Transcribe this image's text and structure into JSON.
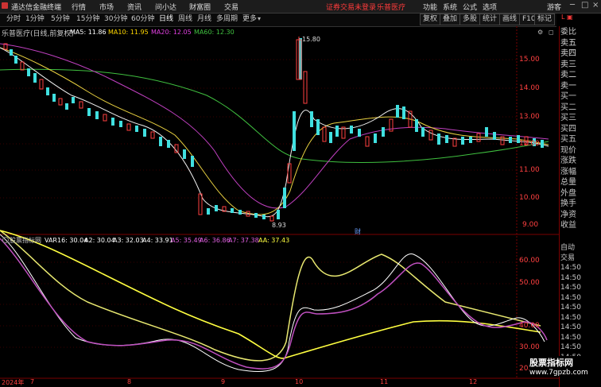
{
  "menubar": {
    "brand": "通达信金融终端",
    "items": [
      "行情",
      "市场",
      "资讯",
      "问小达",
      "财富圈",
      "交易"
    ],
    "alert": "证券交易未登录",
    "stock_name": "乐普医疗",
    "right_items": [
      "功能",
      "系统",
      "公式",
      "选项"
    ],
    "user": "游客"
  },
  "toolbar": {
    "periods": [
      "分时",
      "1分钟",
      "5分钟",
      "15分钟",
      "30分钟",
      "60分钟",
      "日线",
      "周线",
      "月线",
      "多周期",
      "更多"
    ],
    "active": "日线",
    "right_buttons": [
      "复权",
      "叠加",
      "多股",
      "统计",
      "画线",
      "F10",
      "标记"
    ]
  },
  "main_chart": {
    "title": "乐普医疗(日线,前复权)",
    "ma_labels": [
      {
        "text": "MA5: 11.86",
        "color": "#ffffff"
      },
      {
        "text": "MA10: 11.95",
        "color": "#ffd700"
      },
      {
        "text": "MA20: 12.05",
        "color": "#e040e0"
      },
      {
        "text": "MA60: 12.30",
        "color": "#40c040"
      }
    ],
    "high_label": "15.80",
    "low_label": "8.93",
    "event_label": "财",
    "marker_left": "s",
    "marker_mid": "s",
    "y_ticks": [
      "15.00",
      "14.00",
      "13.00",
      "12.00",
      "11.00",
      "10.00",
      "9.00"
    ]
  },
  "indicator": {
    "title": "股票指标网",
    "values": [
      {
        "text": "VAR16: 30.04",
        "color": "#ffffff"
      },
      {
        "text": "A2: 30.04",
        "color": "#ffffff"
      },
      {
        "text": "A3: 32.03",
        "color": "#ffffff"
      },
      {
        "text": "A4: 33.91",
        "color": "#ffffff"
      },
      {
        "text": "A5: 35.49",
        "color": "#e060e0"
      },
      {
        "text": "A6: 36.86",
        "color": "#e060e0"
      },
      {
        "text": "A7: 37.38",
        "color": "#e060e0"
      },
      {
        "text": "AA: 37.43",
        "color": "#ffff40"
      }
    ],
    "y_ticks": [
      "60.00",
      "50.00",
      "40.00",
      "30.00",
      "20.00"
    ]
  },
  "x_labels": [
    "2024年",
    "7",
    "8",
    "9",
    "10",
    "11",
    "12"
  ],
  "right_panel": {
    "labels": [
      "委比",
      "卖五",
      "卖四",
      "卖三",
      "卖二",
      "卖一",
      "买一",
      "买二",
      "买三",
      "买四",
      "买五",
      "现价",
      "涨跌",
      "涨幅",
      "总量",
      "外盘",
      "换手",
      "净资",
      "收益"
    ],
    "lower_labels": [
      "自动",
      "交易",
      "14:50",
      "14:50",
      "14:50",
      "14:50",
      "14:50",
      "14:50",
      "14:50",
      "14:50",
      "14:50",
      "14:50"
    ]
  },
  "watermark": {
    "title": "股票指标网",
    "url": "www.7gpzb.com"
  }
}
